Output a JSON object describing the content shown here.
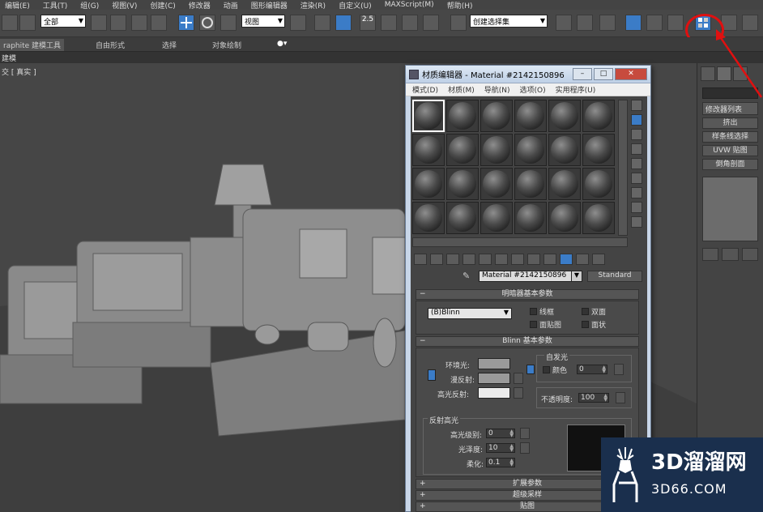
{
  "menu": [
    "编辑(E)",
    "工具(T)",
    "组(G)",
    "视图(V)",
    "创建(C)",
    "修改器",
    "动画",
    "图形编辑器",
    "渲染(R)",
    "自定义(U)",
    "MAXScript(M)",
    "帮助(H)"
  ],
  "toolbar": {
    "selection_filter": "全部",
    "reference_coord": "视图",
    "snap_value": "2.5",
    "named_selection": "创建选择集"
  },
  "ribbon": {
    "tab_graphite": "raphite 建模工具",
    "tab_freeform": "自由形式",
    "tab_selection": "选择",
    "tab_object_paint": "对象绘制"
  },
  "subbar": {
    "label": "建模"
  },
  "viewport": {
    "label": "交 [ 真实 ]"
  },
  "command_panel": {
    "modifier_list": "修改器列表",
    "buttons": [
      "挤出",
      "样条线选择",
      "UVW 贴图",
      "倒角剖面"
    ]
  },
  "material_editor": {
    "title": "材质编辑器 - Material #2142150896",
    "menu": [
      "模式(D)",
      "材质(M)",
      "导航(N)",
      "选项(O)",
      "实用程序(U)"
    ],
    "material_name": "Material #2142150896",
    "material_type": "Standard",
    "shader_rollout": {
      "title": "明暗器基本参数",
      "shader": "(B)Blinn",
      "wire": "线框",
      "two_sided": "双面",
      "face_map": "面贴图",
      "faceted": "面状"
    },
    "blinn_rollout": {
      "title": "Blinn 基本参数",
      "ambient": "环境光:",
      "diffuse": "漫反射:",
      "specular": "高光反射:",
      "self_illum": "自发光",
      "color_label": "颜色",
      "self_illum_value": "0",
      "opacity_label": "不透明度:",
      "opacity_value": "100",
      "spec_group": "反射高光",
      "spec_level_label": "高光级别:",
      "spec_level_value": "0",
      "glossiness_label": "光泽度:",
      "glossiness_value": "10",
      "soften_label": "柔化:",
      "soften_value": "0.1"
    },
    "rollouts_collapsed": [
      "扩展参数",
      "超级采样",
      "贴图"
    ],
    "colors": {
      "ambient": "#9a9a9a",
      "diffuse": "#9a9a9a",
      "specular": "#ececec"
    }
  },
  "watermark": {
    "main": "3D溜溜网",
    "sub": "3D66.COM"
  }
}
